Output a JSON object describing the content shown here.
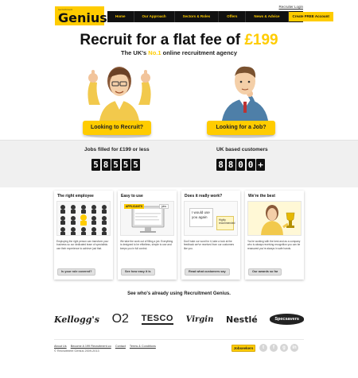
{
  "header": {
    "logo_small": "recruitment",
    "logo_big": "Genius",
    "recruiter_login": "Recruiter Login",
    "nav": [
      {
        "label": "Home"
      },
      {
        "label": "Our Approach"
      },
      {
        "label": "Sectors & Roles"
      },
      {
        "label": "Offers"
      },
      {
        "label": "News & Advice"
      }
    ],
    "cta": "Create FREE Account"
  },
  "hero": {
    "title_prefix": "Recruit for a flat fee of ",
    "title_price": "£199",
    "sub_prefix": "The UK's ",
    "sub_no1": "No.1",
    "sub_suffix": " online recruitment agency",
    "left_button": "Looking to Recruit?",
    "right_button": "Looking for a Job?"
  },
  "stats": {
    "left_label": "Jobs filled for £199 or less",
    "left_digits": [
      "5",
      "8",
      "5",
      "5",
      "5"
    ],
    "right_label": "UK based customers",
    "right_digits": [
      "8",
      "8",
      "0",
      "0",
      "+"
    ]
  },
  "cards": [
    {
      "title": "The right employee",
      "text": "Employing the right person can transform your business so our dedicated team of specialists use their experience to achieve just that.",
      "button": "Is your role covered?"
    },
    {
      "title": "Easy to use",
      "text": "We take the work out of filling a job. Everything is designed to be effortless, simple to use and keeps you in full control.",
      "button": "See how easy it is",
      "illus_tag": "APPLICANTS",
      "illus_tag2": "jobs"
    },
    {
      "title": "Does it really work?",
      "text": "Don't take our word for it, take a look at the feedback we've received from our customers like you.",
      "button": "Read what customers say",
      "quote1": "I would use you again",
      "quote2": "Highly recommended"
    },
    {
      "title": "We're the best",
      "text": "You're working with the best and as a company who is always receiving recognition you can be reassured you're always in safe hands.",
      "button": "Our awards so far"
    }
  ],
  "clients": {
    "title": "See who's already using Recruitment Genius.",
    "logos": [
      "Kellogg's",
      "O2",
      "TESCO",
      "Virgin",
      "Nestlé",
      "Specsavers"
    ]
  },
  "footer": {
    "links": [
      "About Us",
      "Become A 199 Recruitment.co",
      "Contact",
      "Terms & Conditions"
    ],
    "copyright": "© Recruitment Genius 2009-2013",
    "jobseekers": "Jobseekers",
    "socials": [
      "t",
      "f",
      "g",
      "in"
    ]
  },
  "colors": {
    "brand_yellow": "#ffcc00",
    "nav_black": "#111111"
  }
}
